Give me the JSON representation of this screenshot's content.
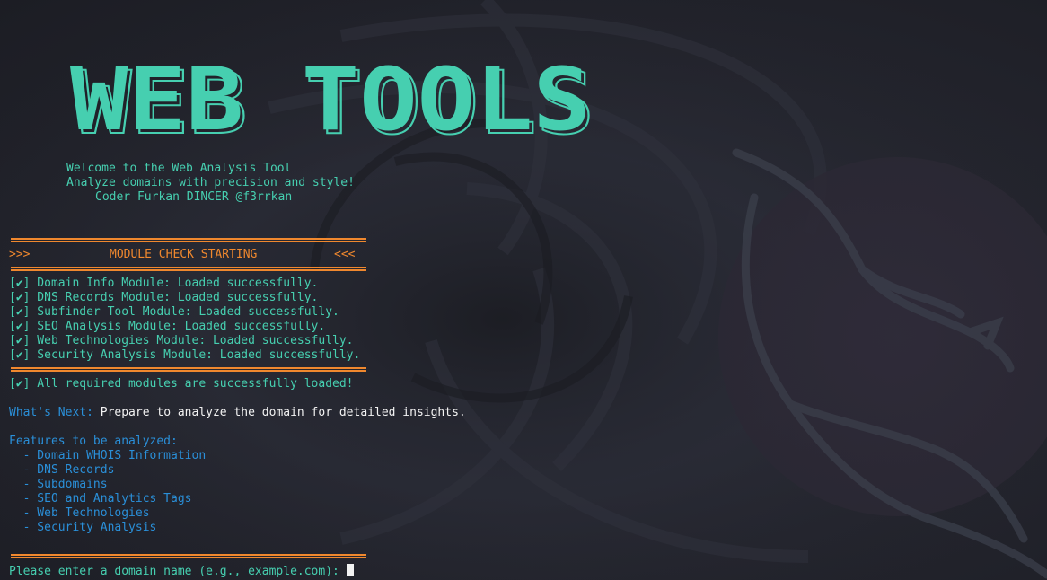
{
  "banner": {
    "title": "WEB TOOLS",
    "welcome": "Welcome to the Web Analysis Tool",
    "tagline": "Analyze domains with precision and style!",
    "credit": "Coder Furkan DINCER @f3rrkan"
  },
  "module_check": {
    "left_marker": ">>>",
    "heading": "MODULE CHECK STARTING",
    "right_marker": "<<<",
    "modules": [
      "[✔] Domain Info Module: Loaded successfully.",
      "[✔] DNS Records Module: Loaded successfully.",
      "[✔] Subfinder Tool Module: Loaded successfully.",
      "[✔] SEO Analysis Module: Loaded successfully.",
      "[✔] Web Technologies Module: Loaded successfully.",
      "[✔] Security Analysis Module: Loaded successfully."
    ],
    "summary": "[✔] All required modules are successfully loaded!"
  },
  "next_step": {
    "label": "What's Next:",
    "text": "Prepare to analyze the domain for detailed insights."
  },
  "features": {
    "heading": "Features to be analyzed:",
    "items": [
      "  - Domain WHOIS Information",
      "  - DNS Records",
      "  - Subdomains",
      "  - SEO and Analytics Tags",
      "  - Web Technologies",
      "  - Security Analysis"
    ]
  },
  "prompt": {
    "text": "Please enter a domain name (e.g., example.com): ",
    "value": ""
  },
  "colors": {
    "teal": "#46cfb0",
    "orange": "#f0882e",
    "blue": "#2a8fd8",
    "white": "#f2f2f2",
    "background": "#24252e"
  }
}
